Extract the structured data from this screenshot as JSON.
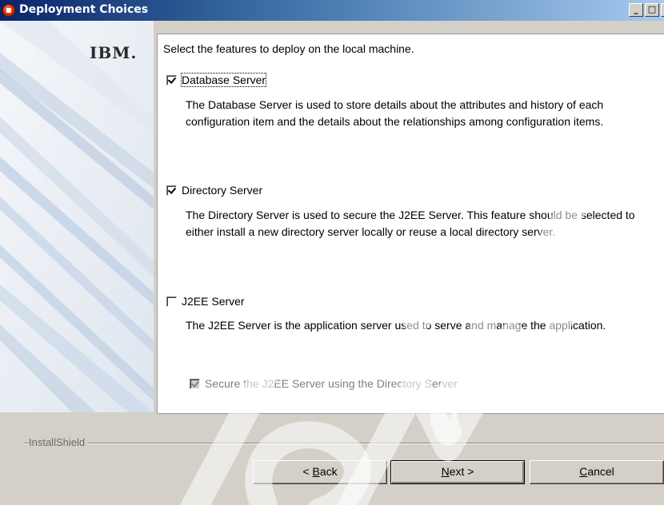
{
  "window": {
    "title": "Deployment Choices",
    "icon": "installer-icon",
    "controls": {
      "minimize": "_",
      "maximize": "□",
      "close": "×"
    }
  },
  "branding": {
    "logo": "IBM."
  },
  "content": {
    "intro": "Select the features to deploy on the local machine.",
    "features": [
      {
        "label": "Database Server",
        "checked": true,
        "description": "The Database Server is used to store details about the attributes and history of each configuration item and the details about the relationships among configuration items."
      },
      {
        "label": "Directory Server",
        "checked": true,
        "description": "The Directory Server is used to secure the J2EE Server. This feature should be selected to either install a new directory server locally or reuse a local directory server."
      },
      {
        "label": "J2EE Server",
        "checked": false,
        "description": "The J2EE Server is the application server used to serve and manage the application."
      }
    ],
    "sub_option": {
      "label": "Secure the J2EE Server using the Directory Server",
      "checked": true,
      "enabled": false
    }
  },
  "footer": {
    "brand": "InstallShield",
    "back_prefix": "< ",
    "back_mnemonic": "B",
    "back_rest": "ack",
    "next_mnemonic": "N",
    "next_rest": "ext >",
    "cancel_mnemonic": "C",
    "cancel_rest": "ancel"
  },
  "colors": {
    "titlebar_start": "#0a246a",
    "titlebar_end": "#a6caf0",
    "dialog_bg": "#d4d0c8",
    "panel_bg": "#ffffff"
  }
}
